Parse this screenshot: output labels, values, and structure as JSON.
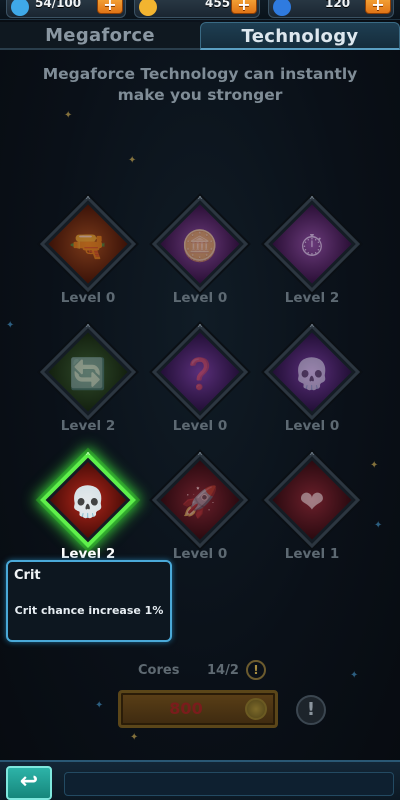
{
  "resources": [
    {
      "name": "energy",
      "value": "54/100",
      "icon": "lightning-icon",
      "color": "#3fa9e8"
    },
    {
      "name": "gold",
      "value": "455",
      "icon": "gold-coin-icon",
      "color": "#f2b430"
    },
    {
      "name": "gems",
      "value": "120",
      "icon": "blue-gem-icon",
      "color": "#2f7be0"
    }
  ],
  "plus_label": "+",
  "tabs": [
    {
      "label": "Megaforce",
      "active": false
    },
    {
      "label": "Technology",
      "active": true
    }
  ],
  "subtitle": "Megaforce Technology can instantly make you stronger",
  "techs": [
    {
      "icon": "cannon-icon",
      "level": "Level 0"
    },
    {
      "icon": "coin-stack-icon",
      "level": "Level 0"
    },
    {
      "icon": "clock-icon",
      "level": "Level 2"
    },
    {
      "icon": "cycle-arrows-icon",
      "level": "Level 2"
    },
    {
      "icon": "mystery-box-icon",
      "level": "Level 0"
    },
    {
      "icon": "winged-skull-icon",
      "level": "Level 0"
    },
    {
      "icon": "crit-skull-icon",
      "level": "Level 2"
    },
    {
      "icon": "rocket-icon",
      "level": "Level 0"
    },
    {
      "icon": "heart-shield-icon",
      "level": "Level 1"
    }
  ],
  "tooltip": {
    "title": "Crit",
    "description": "Crit chance increase 1%"
  },
  "cores": {
    "label": "Cores",
    "count": "14/2"
  },
  "upgrade": {
    "cost": "800",
    "icon": "coin-icon"
  },
  "warning_label": "!",
  "back_icon": "return-arrow-icon",
  "colors": {
    "accent_green": "#5ef04a",
    "accent_blue": "#4aa9d8",
    "tab_active": "#1e3e52",
    "plus_orange": "#f08a26"
  }
}
